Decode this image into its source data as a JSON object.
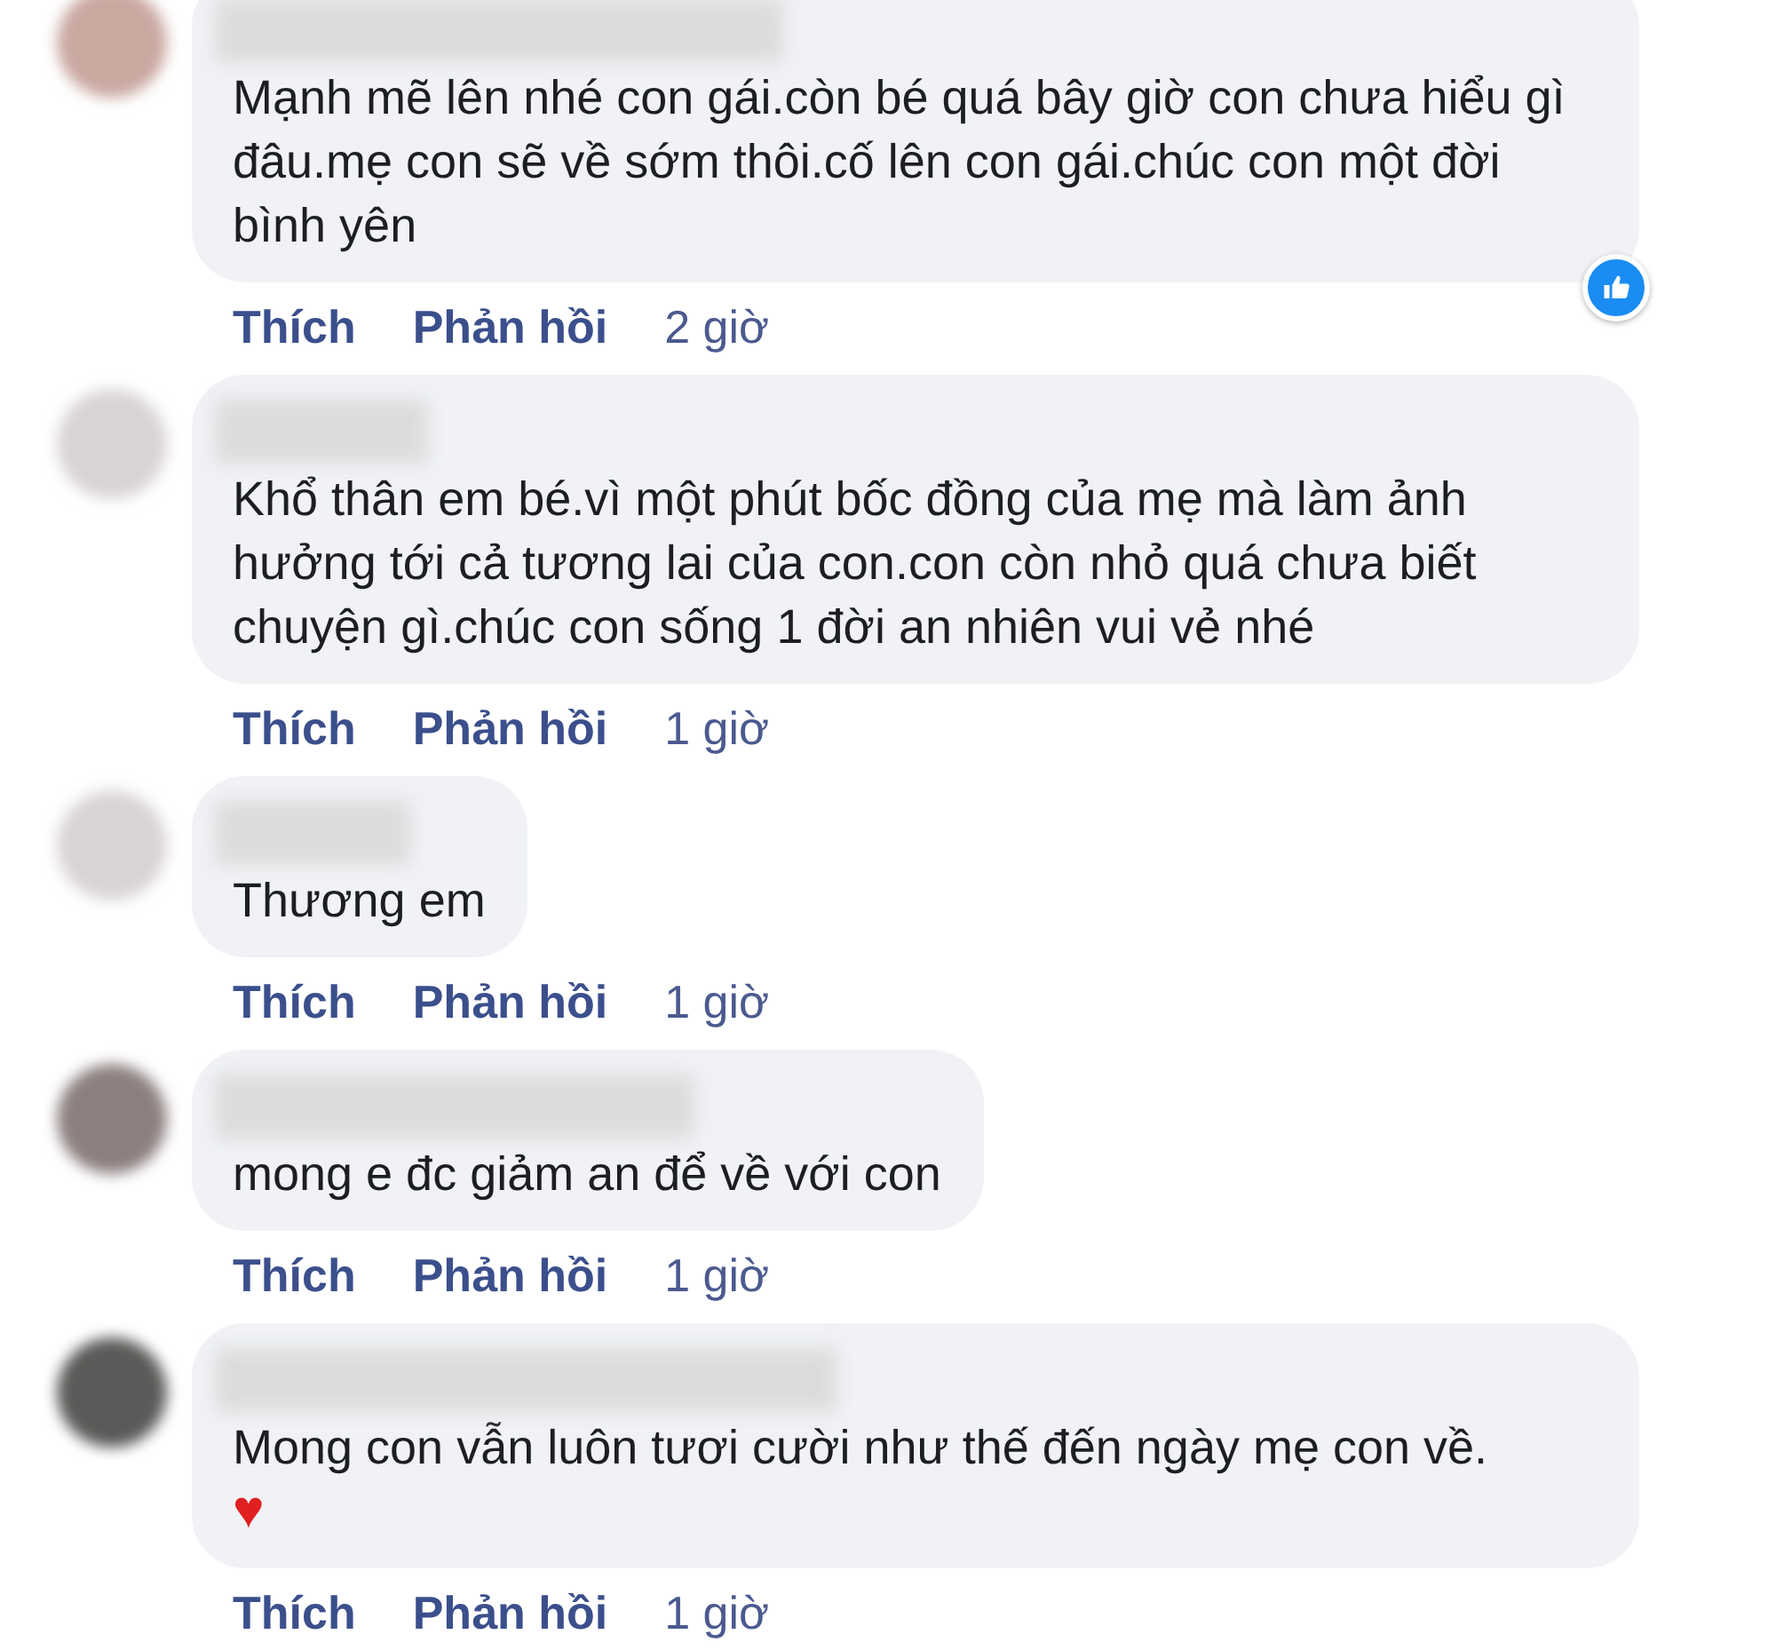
{
  "comments": [
    {
      "text": "Mạnh mẽ lên nhé con gái.còn bé quá bây giờ con chưa hiểu gì đâu.mẹ con sẽ về sớm thôi.cố lên con gái.chúc con một đời bình yên",
      "liked": true,
      "actions": [
        "Thích",
        "Phản hồi"
      ],
      "time": "2 giờ"
    },
    {
      "text": "Khổ thân em bé.vì một phút bốc đồng của mẹ mà làm ảnh hưởng tới cả tương lai của con.con còn nhỏ quá chưa biết chuyện gì.chúc con sống 1 đời an nhiên vui vẻ nhé",
      "actions": [
        "Thích",
        "Phản hồi"
      ],
      "time": "1 giờ"
    },
    {
      "text": "Thương em",
      "actions": [
        "Thích",
        "Phản hồi"
      ],
      "time": "1 giờ"
    },
    {
      "text": "mong e đc giảm an để về với con",
      "actions": [
        "Thích",
        "Phản hồi"
      ],
      "time": "1 giờ"
    },
    {
      "text": "Mong con vẫn luôn tươi cười như thế đến ngày mẹ con về.",
      "emoji": "♥",
      "actions": [
        "Thích",
        "Phản hồi"
      ],
      "time": "1 giờ"
    }
  ]
}
